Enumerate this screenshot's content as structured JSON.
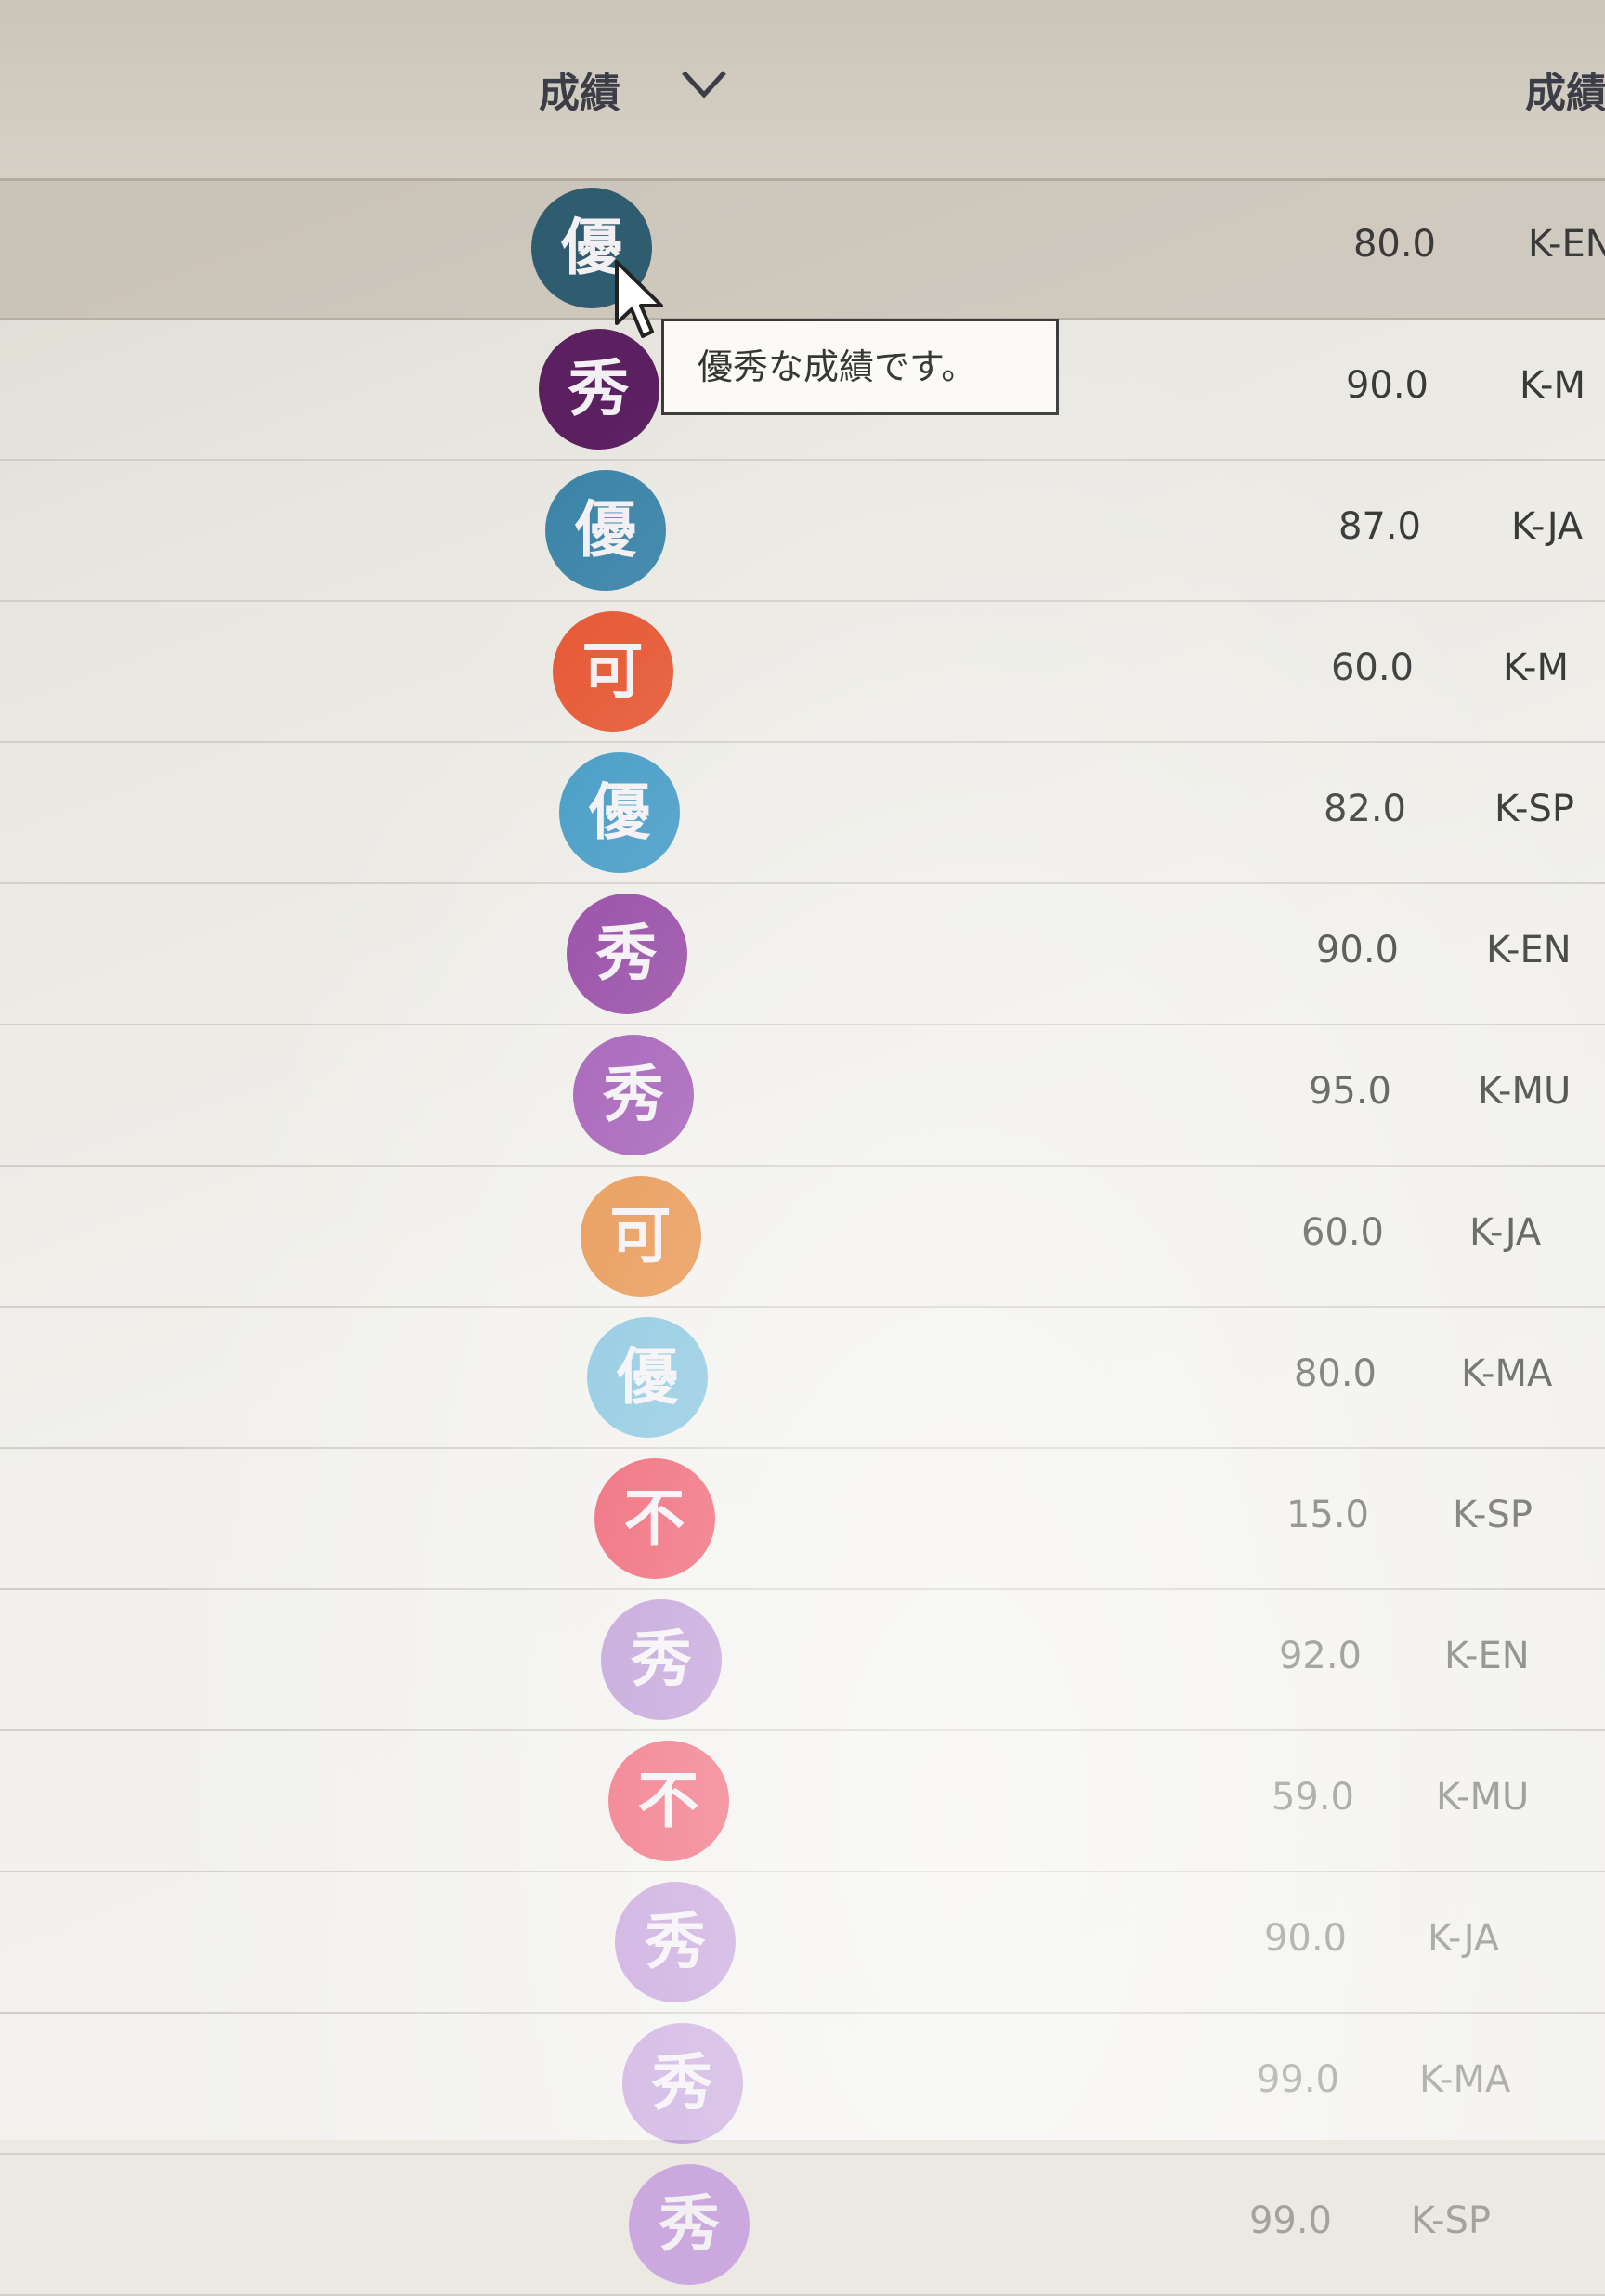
{
  "header": {
    "grade_label": "成績",
    "score_label": "成績"
  },
  "tooltip": {
    "text": "優秀な成績です。"
  },
  "rows": [
    {
      "grade": "優",
      "color": "#2f5c6e",
      "score": "80.0",
      "code": "K-EN"
    },
    {
      "grade": "秀",
      "color": "#5b2060",
      "score": "90.0",
      "code": "K-M"
    },
    {
      "grade": "優",
      "color": "#3b84a8",
      "score": "87.0",
      "code": "K-JA"
    },
    {
      "grade": "可",
      "color": "#e5532e",
      "score": "60.0",
      "code": "K-M"
    },
    {
      "grade": "優",
      "color": "#3d97c4",
      "score": "82.0",
      "code": "K-SP"
    },
    {
      "grade": "秀",
      "color": "#8e3c9e",
      "score": "90.0",
      "code": "K-EN"
    },
    {
      "grade": "秀",
      "color": "#9a4eb0",
      "score": "95.0",
      "code": "K-MU"
    },
    {
      "grade": "可",
      "color": "#e5893b",
      "score": "60.0",
      "code": "K-JA"
    },
    {
      "grade": "優",
      "color": "#7cc0dc",
      "score": "80.0",
      "code": "K-MA"
    },
    {
      "grade": "不",
      "color": "#ec4a5c",
      "score": "15.0",
      "code": "K-SP"
    },
    {
      "grade": "秀",
      "color": "#b690d2",
      "score": "92.0",
      "code": "K-EN"
    },
    {
      "grade": "不",
      "color": "#ee5a6c",
      "score": "59.0",
      "code": "K-MU"
    },
    {
      "grade": "秀",
      "color": "#c09ad8",
      "score": "90.0",
      "code": "K-JA"
    },
    {
      "grade": "秀",
      "color": "#c6a4dc",
      "score": "99.0",
      "code": "K-MA"
    },
    {
      "grade": "秀",
      "color": "#cba9df",
      "score": "99.0",
      "code": "K-SP"
    }
  ]
}
